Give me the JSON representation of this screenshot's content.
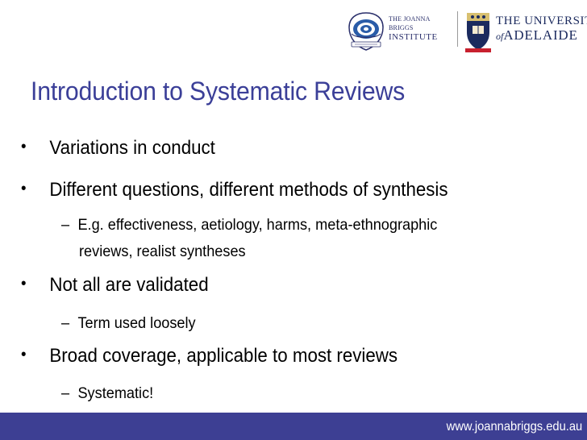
{
  "logos": {
    "jbi_line1": "THE JOANNA BRIGGS",
    "jbi_line2": "INSTITUTE",
    "adelaide_line1": "THE UNIVERSITY",
    "adelaide_of": "of",
    "adelaide_line2": "ADELAIDE"
  },
  "slide": {
    "title": "Introduction to Systematic Reviews",
    "bullets": [
      {
        "text": "Variations in conduct"
      },
      {
        "text": "Different questions, different methods of synthesis"
      },
      {
        "text": "E.g. effectiveness, aetiology, harms, meta-ethnographic"
      },
      {
        "text": "reviews, realist syntheses"
      },
      {
        "text": "Not all are validated"
      },
      {
        "text": "Term used loosely"
      },
      {
        "text": "Broad coverage, applicable to most reviews"
      },
      {
        "text": "Systematic!"
      }
    ]
  },
  "footer": {
    "url": "www.joannabriggs.edu.au"
  },
  "colors": {
    "title": "#3b3f98",
    "footer_bar": "#3d3f93",
    "text": "#000000"
  }
}
